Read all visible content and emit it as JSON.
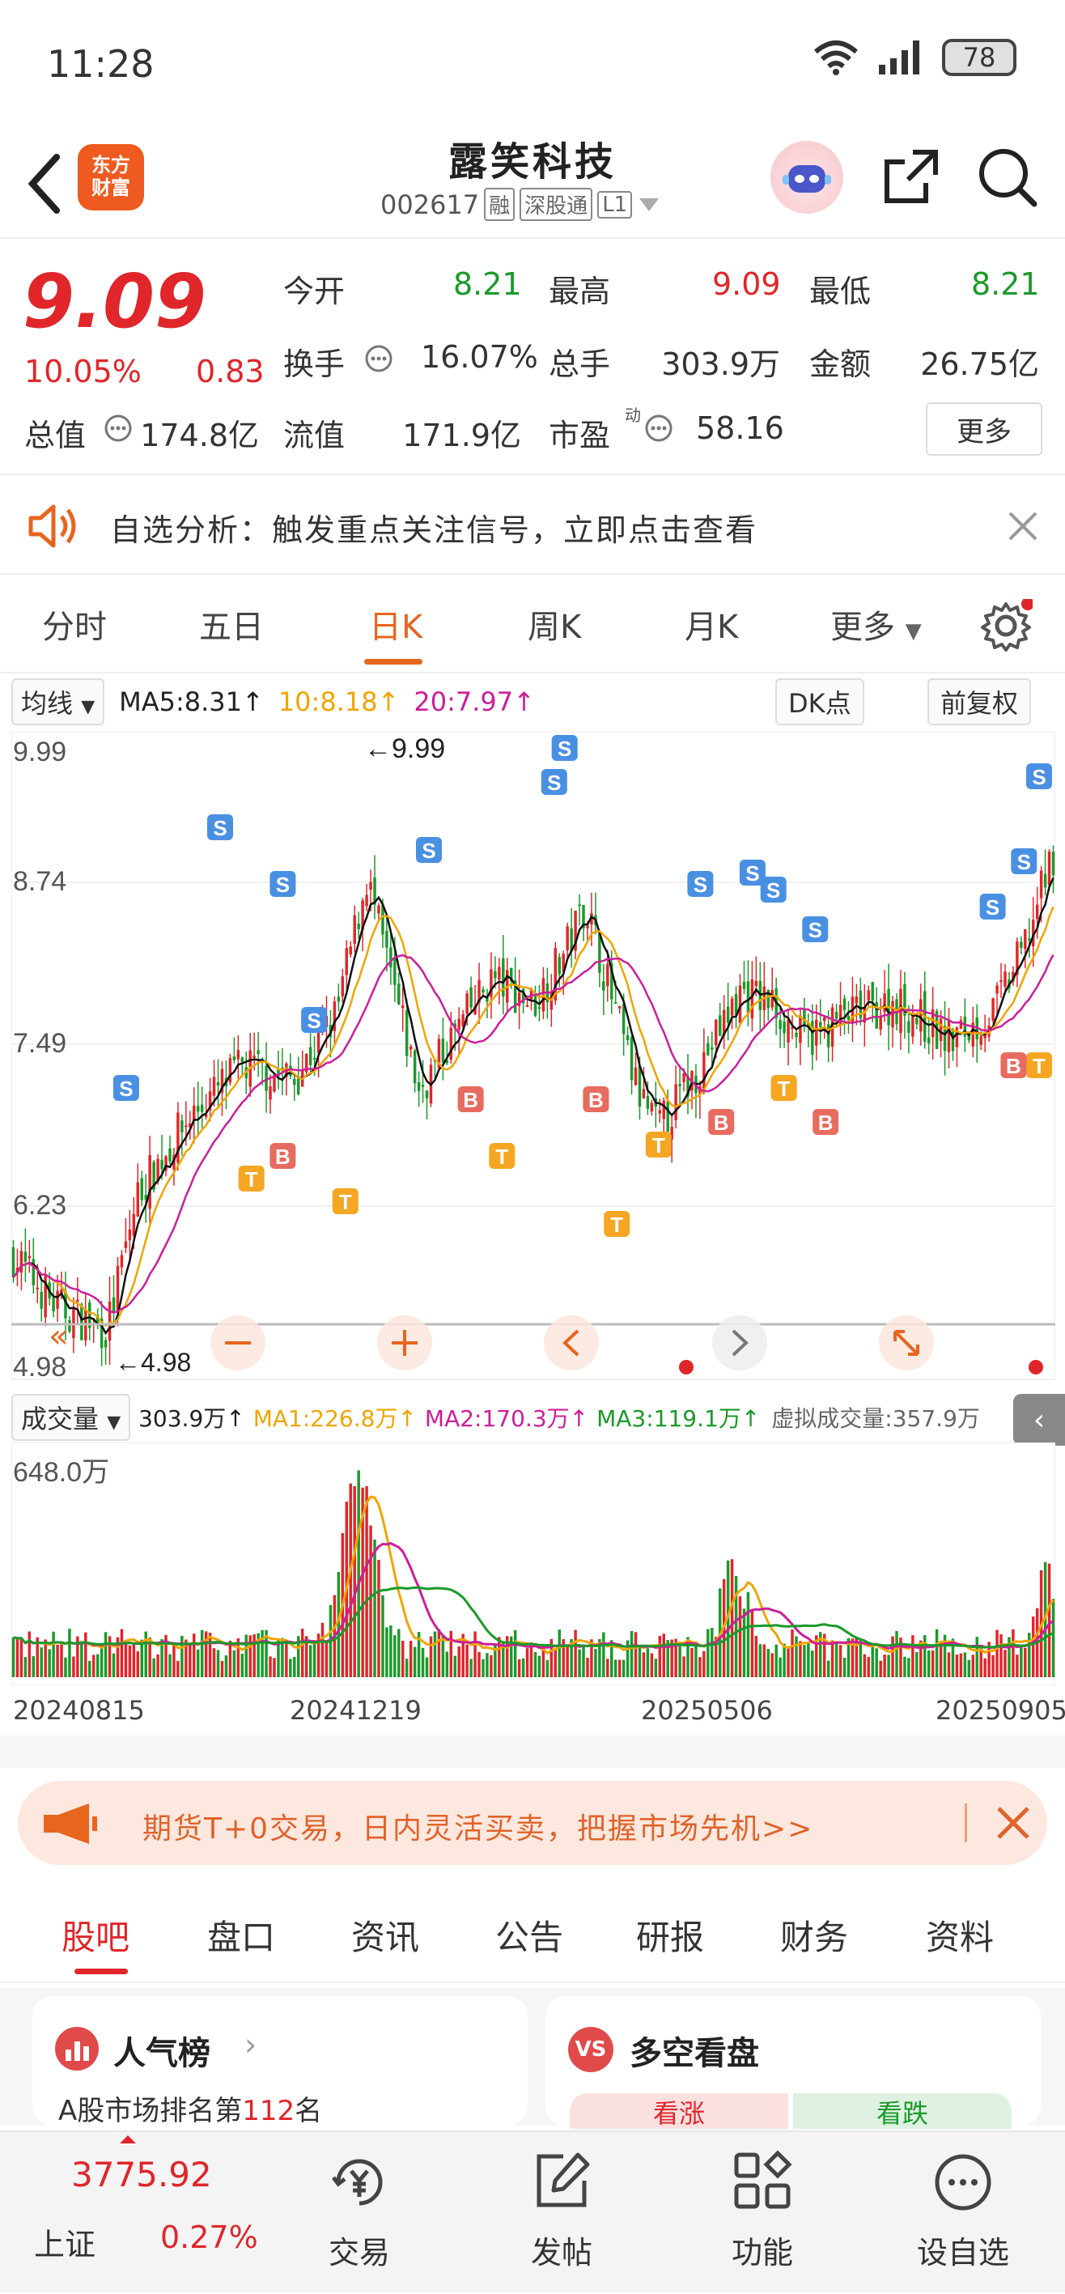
{
  "status": {
    "time": "11:28",
    "battery": "78"
  },
  "header": {
    "logo_line1": "东方",
    "logo_line2": "财富",
    "stock_name": "露笑科技",
    "stock_code": "002617",
    "tags": [
      "融",
      "深股通",
      "L1"
    ]
  },
  "quote": {
    "price": "9.09",
    "change_pct": "10.05%",
    "change": "0.83",
    "labels": {
      "open": "今开",
      "high": "最高",
      "low": "最低",
      "turnover": "换手",
      "volume": "总手",
      "amount": "金额",
      "total_mv": "总值",
      "float_mv": "流值",
      "pe": "市盈"
    },
    "open": "8.21",
    "high": "9.09",
    "low": "8.21",
    "turnover": "16.07%",
    "volume": "303.9万",
    "amount": "26.75亿",
    "total_mv": "174.8亿",
    "float_mv": "171.9亿",
    "pe": "58.16",
    "pe_sup": "动",
    "more": "更多"
  },
  "notice": {
    "text": "自选分析：触发重点关注信号，立即点击查看"
  },
  "period_tabs": [
    "分时",
    "五日",
    "日K",
    "周K",
    "月K",
    "更多"
  ],
  "active_tab": "日K",
  "ma_bar": {
    "selector": "均线",
    "ma5": "MA5:8.31↑",
    "ma10": "10:8.18↑",
    "ma20": "20:7.97↑",
    "dk": "DK点",
    "adjust": "前复权"
  },
  "price_axis": [
    "9.99",
    "8.74",
    "7.49",
    "6.23",
    "4.98"
  ],
  "max_label": "←9.99",
  "min_label": "←4.98",
  "chart_colors": {
    "up": "#e0262a",
    "down": "#1a9a2a",
    "ma5": "#111111",
    "ma10": "#f0a500",
    "ma20": "#cc1f9a",
    "buy": "#e86b5f",
    "sell": "#4a90e2",
    "trade": "#f5a623"
  },
  "volume_bar": {
    "selector": "成交量",
    "vol": "303.9万↑",
    "ma1": "MA1:226.8万↑",
    "ma2": "MA2:170.3万↑",
    "ma3": "MA3:119.1万↑",
    "virtual": "虚拟成交量:357.9万"
  },
  "volume_axis": "648.0万",
  "dates": [
    "20240815",
    "20241219",
    "20250506",
    "20250905"
  ],
  "ad": {
    "text": "期货T+0交易，日内灵活买卖，把握市场先机>>"
  },
  "sub_tabs": [
    "股吧",
    "盘口",
    "资讯",
    "公告",
    "研报",
    "财务",
    "资料"
  ],
  "cards": {
    "left_title": "人气榜",
    "left_text_prefix": "A股市场排名第",
    "left_rank": "112",
    "left_text_suffix": "名",
    "right_title": "多空看盘",
    "right_badge": "VS",
    "bull": "看涨",
    "bear": "看跌"
  },
  "bottom_nav": {
    "index_value": "3775.92",
    "index_name": "上证",
    "index_change": "0.27%",
    "items": [
      "交易",
      "发帖",
      "功能",
      "设自选"
    ]
  }
}
